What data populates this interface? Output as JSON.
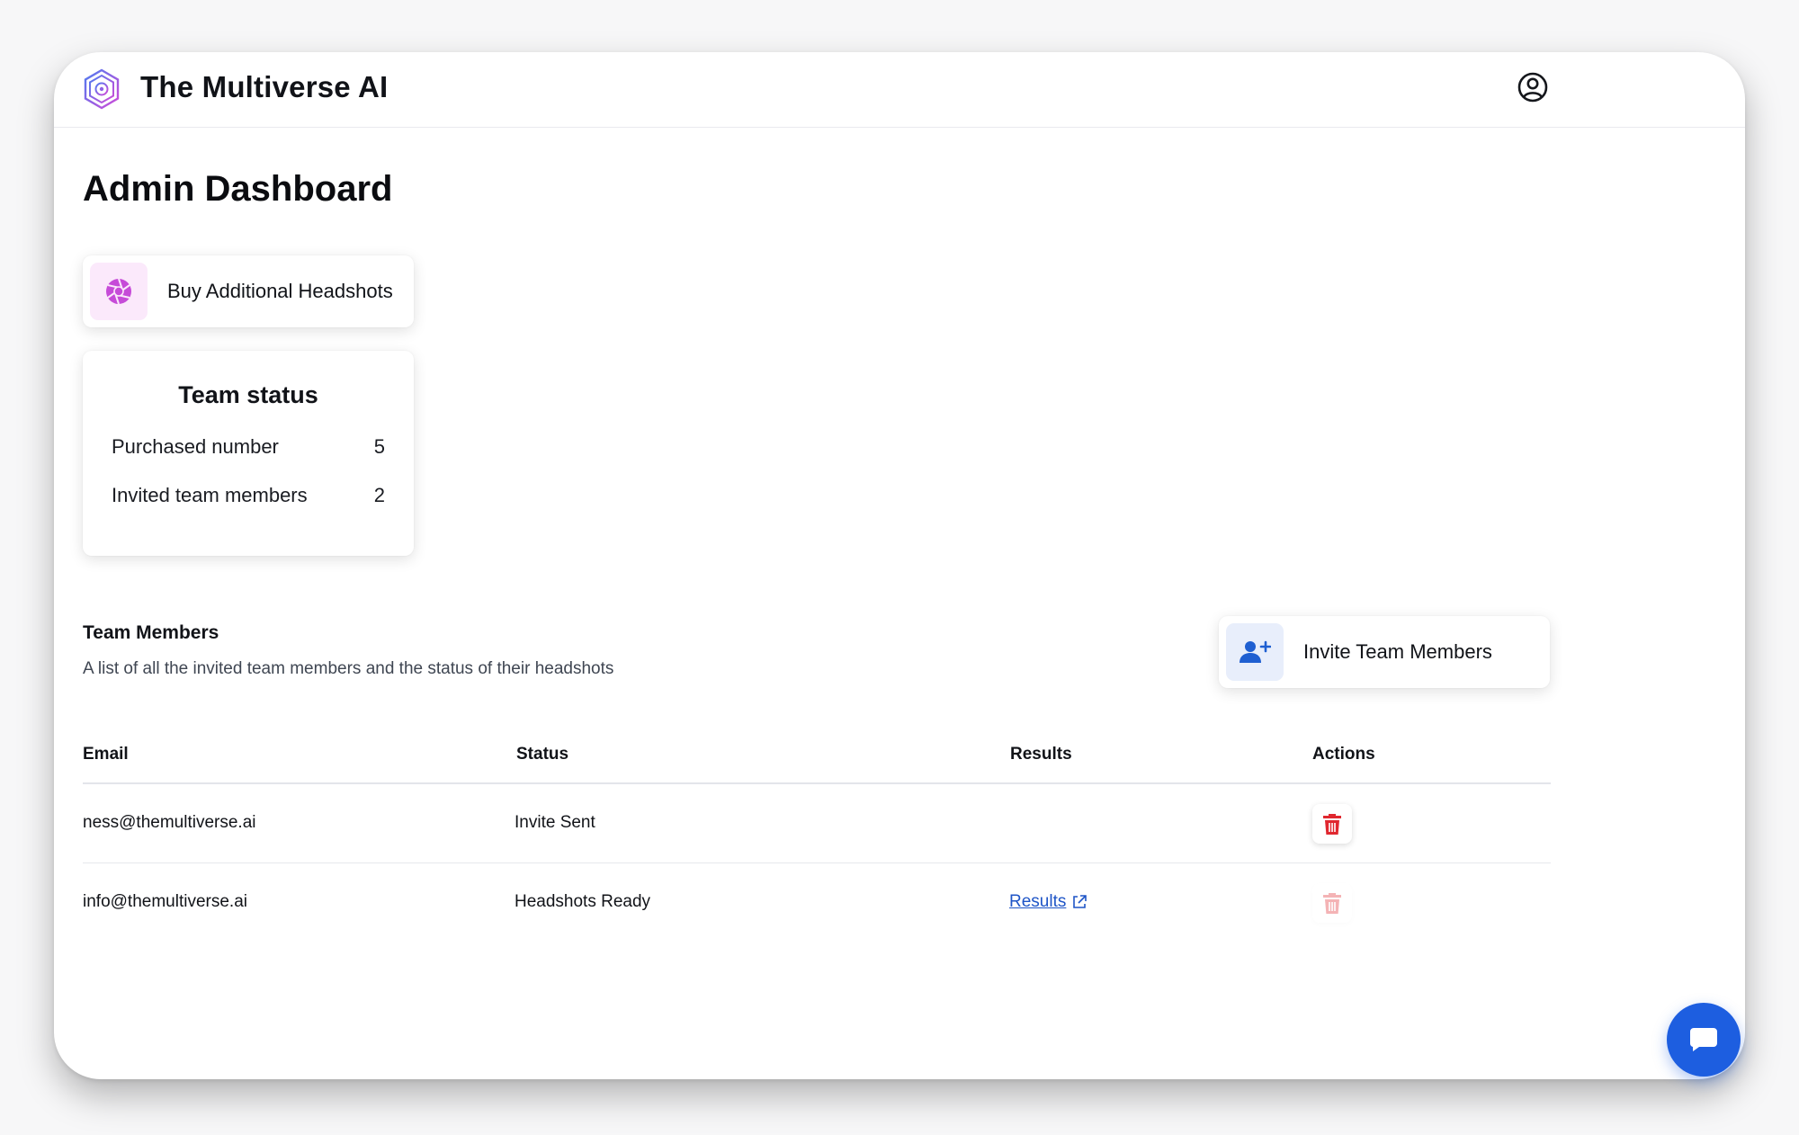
{
  "app": {
    "brand": "The Multiverse AI",
    "logo_icon": "multiverse-logo",
    "user_icon": "user-circle-icon"
  },
  "page": {
    "title": "Admin Dashboard"
  },
  "buy_card": {
    "label": "Buy Additional Headshots",
    "icon": "camera-aperture-icon",
    "accent": "#c64bd8"
  },
  "team_status": {
    "title": "Team status",
    "rows": [
      {
        "label": "Purchased number",
        "value": "5"
      },
      {
        "label": "Invited team members",
        "value": "2"
      }
    ]
  },
  "team_members": {
    "title": "Team Members",
    "description": "A list of all the invited team members and the status of their headshots",
    "invite_label": "Invite Team Members",
    "invite_icon": "user-plus-icon",
    "invite_accent": "#1f5fd1"
  },
  "table": {
    "headers": {
      "email": "Email",
      "status": "Status",
      "results": "Results",
      "actions": "Actions"
    },
    "rows": [
      {
        "email": "ness@themultiverse.ai",
        "status": "Invite Sent",
        "results": "",
        "delete_enabled": true
      },
      {
        "email": "info@themultiverse.ai",
        "status": "Headshots Ready",
        "results": "Results",
        "delete_enabled": false
      }
    ],
    "delete_color": "#e0272f",
    "link_color": "#1f55c7"
  },
  "chat": {
    "icon": "chat-bubble-icon",
    "color": "#1d5ee0"
  }
}
